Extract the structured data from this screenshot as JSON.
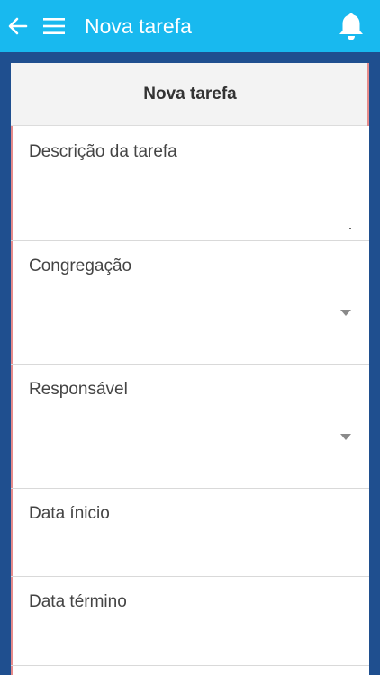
{
  "appbar": {
    "title": "Nova tarefa",
    "back_icon": "arrow-left-icon",
    "menu_icon": "hamburger-icon",
    "notifications_icon": "bell-icon",
    "color": "#18b9ef"
  },
  "form": {
    "header": "Nova tarefa",
    "fields": [
      {
        "label": "Descrição da tarefa",
        "type": "textarea"
      },
      {
        "label": "Congregação",
        "type": "select"
      },
      {
        "label": "Responsável",
        "type": "select"
      },
      {
        "label": "Data ínicio",
        "type": "date"
      },
      {
        "label": "Data término",
        "type": "date"
      }
    ]
  },
  "colors": {
    "background": "#1f4f8f",
    "accent": "#e58b8b"
  }
}
